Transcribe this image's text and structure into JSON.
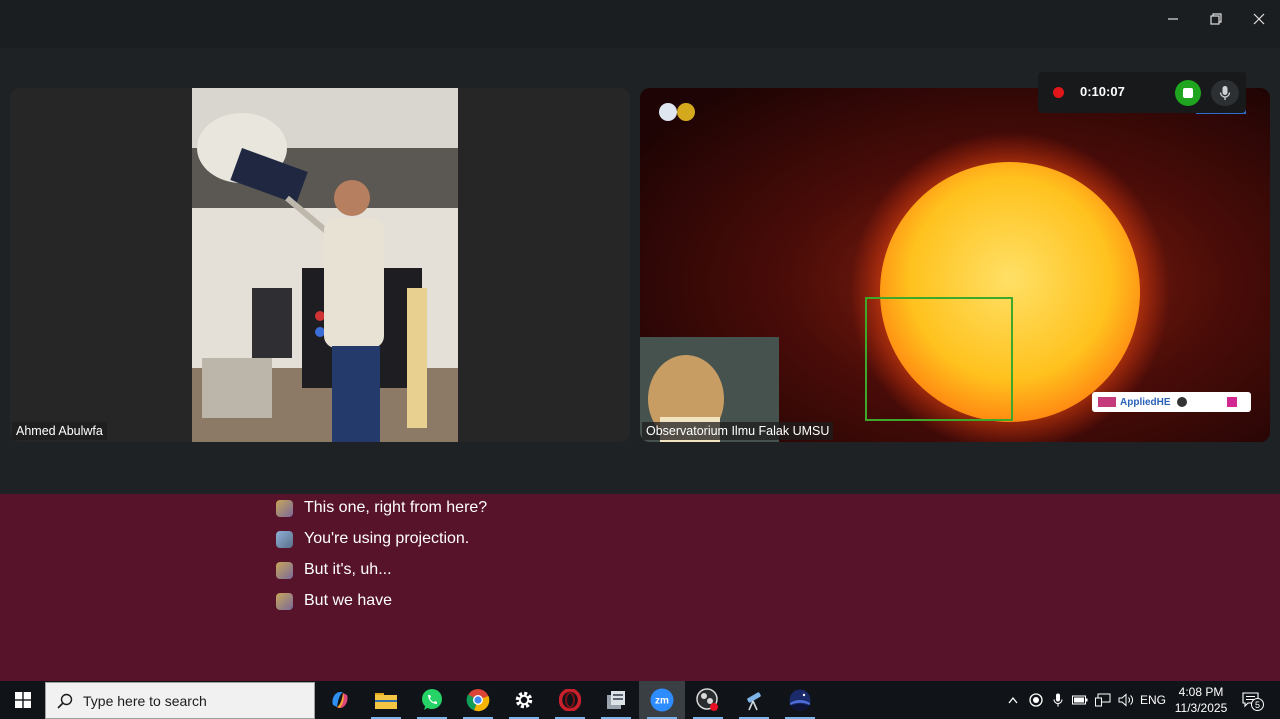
{
  "window": {
    "minimize_label": "Minimize",
    "restore_label": "Restore",
    "close_label": "Close"
  },
  "recording": {
    "elapsed": "0:10:07",
    "stop_label": "Stop recording",
    "mic_label": "Microphone"
  },
  "participants": [
    {
      "name": "Ahmed Abulwfa"
    },
    {
      "name": "Observatorium Ilmu Falak UMSU"
    }
  ],
  "shared_screen": {
    "sponsor_text": "AppliedHE"
  },
  "captions": [
    {
      "text": "This one, right from here?"
    },
    {
      "text": "You're using projection."
    },
    {
      "text": "But it's, uh..."
    },
    {
      "text": "But we have"
    }
  ],
  "taskbar": {
    "search_placeholder": "Type here to search",
    "apps": [
      "Copilot",
      "File Explorer",
      "WhatsApp",
      "Google Chrome",
      "Settings",
      "Opera",
      "Server Manager",
      "Zoom",
      "OBS Studio",
      "Telescope app",
      "Stellarium"
    ],
    "active_app": "Zoom",
    "language": "ENG",
    "time": "4:08 PM",
    "date": "11/3/2025",
    "notifications_count": "5"
  },
  "colors": {
    "caption_bg": "#561329",
    "record_dot": "#e0161a",
    "stop_button": "#1fa51f",
    "taskbar_bg": "#101418"
  }
}
